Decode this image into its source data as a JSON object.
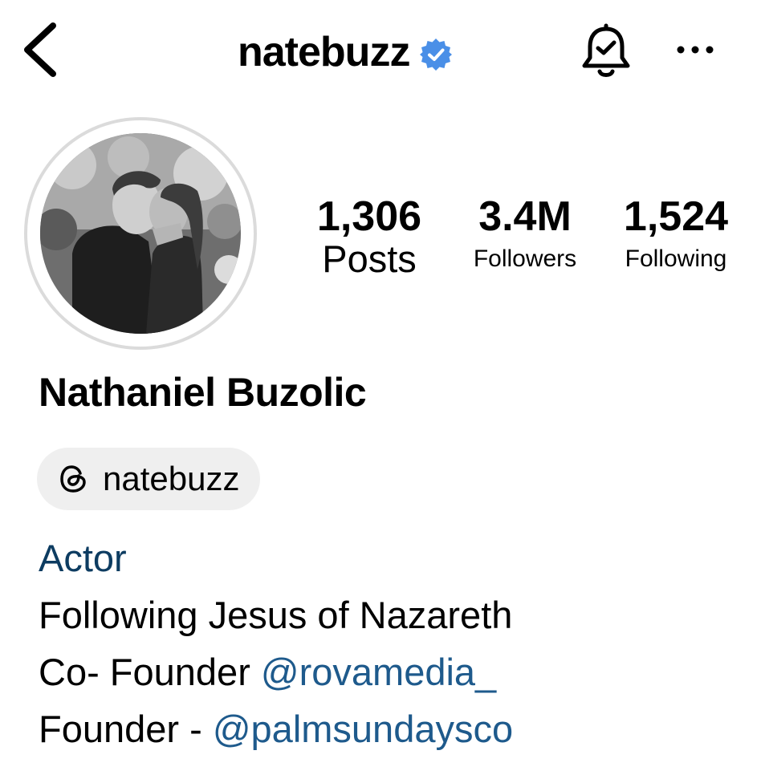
{
  "header": {
    "title": "natebuzz",
    "back_icon": "chevron-left-icon",
    "verified_icon": "verified-badge-icon",
    "bell_icon": "bell-check-icon",
    "more_icon": "more-horizontal-icon",
    "verified_color": "#4a8fe7"
  },
  "profile": {
    "avatar_icon": "profile-photo",
    "stats": [
      {
        "value": "1,306",
        "label": "Posts"
      },
      {
        "value": "3.4M",
        "label": "Followers"
      },
      {
        "value": "1,524",
        "label": "Following"
      }
    ],
    "name": "Nathaniel Buzolic",
    "threads": {
      "icon": "threads-icon",
      "handle": "natebuzz"
    },
    "bio": {
      "category": "Actor",
      "line1": "Following Jesus of Nazareth",
      "line2_text": "Co- Founder ",
      "line2_mention": "@rovamedia_",
      "line3_text": "Founder - ",
      "line3_mention": "@palmsundaysco"
    }
  },
  "colors": {
    "category": "#0d3c61",
    "mention": "#1e5a8c",
    "pill_bg": "#efefef"
  }
}
